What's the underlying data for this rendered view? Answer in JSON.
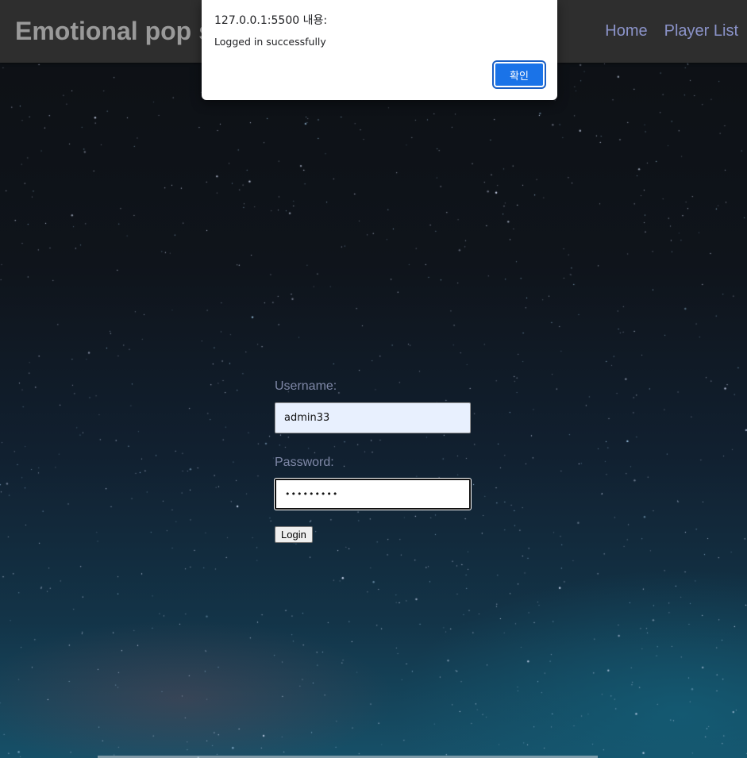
{
  "navbar": {
    "title": "Emotional pop s",
    "links": [
      {
        "label": "Home"
      },
      {
        "label": "Player List"
      }
    ]
  },
  "login": {
    "username_label": "Username:",
    "username_value": "admin33",
    "password_label": "Password:",
    "password_value": "•••••••••",
    "button_label": "Login"
  },
  "dialog": {
    "title": "127.0.0.1:5500 내용:",
    "message": "Logged in successfully",
    "ok_label": "확인"
  },
  "colors": {
    "navbar_bg": "#2e2e2e",
    "title_text": "#9a9a9a",
    "nav_link": "#8b93c9",
    "form_label": "#7f88a7",
    "dialog_button": "#1a73e8",
    "autofill_bg": "#e8f0fe"
  }
}
